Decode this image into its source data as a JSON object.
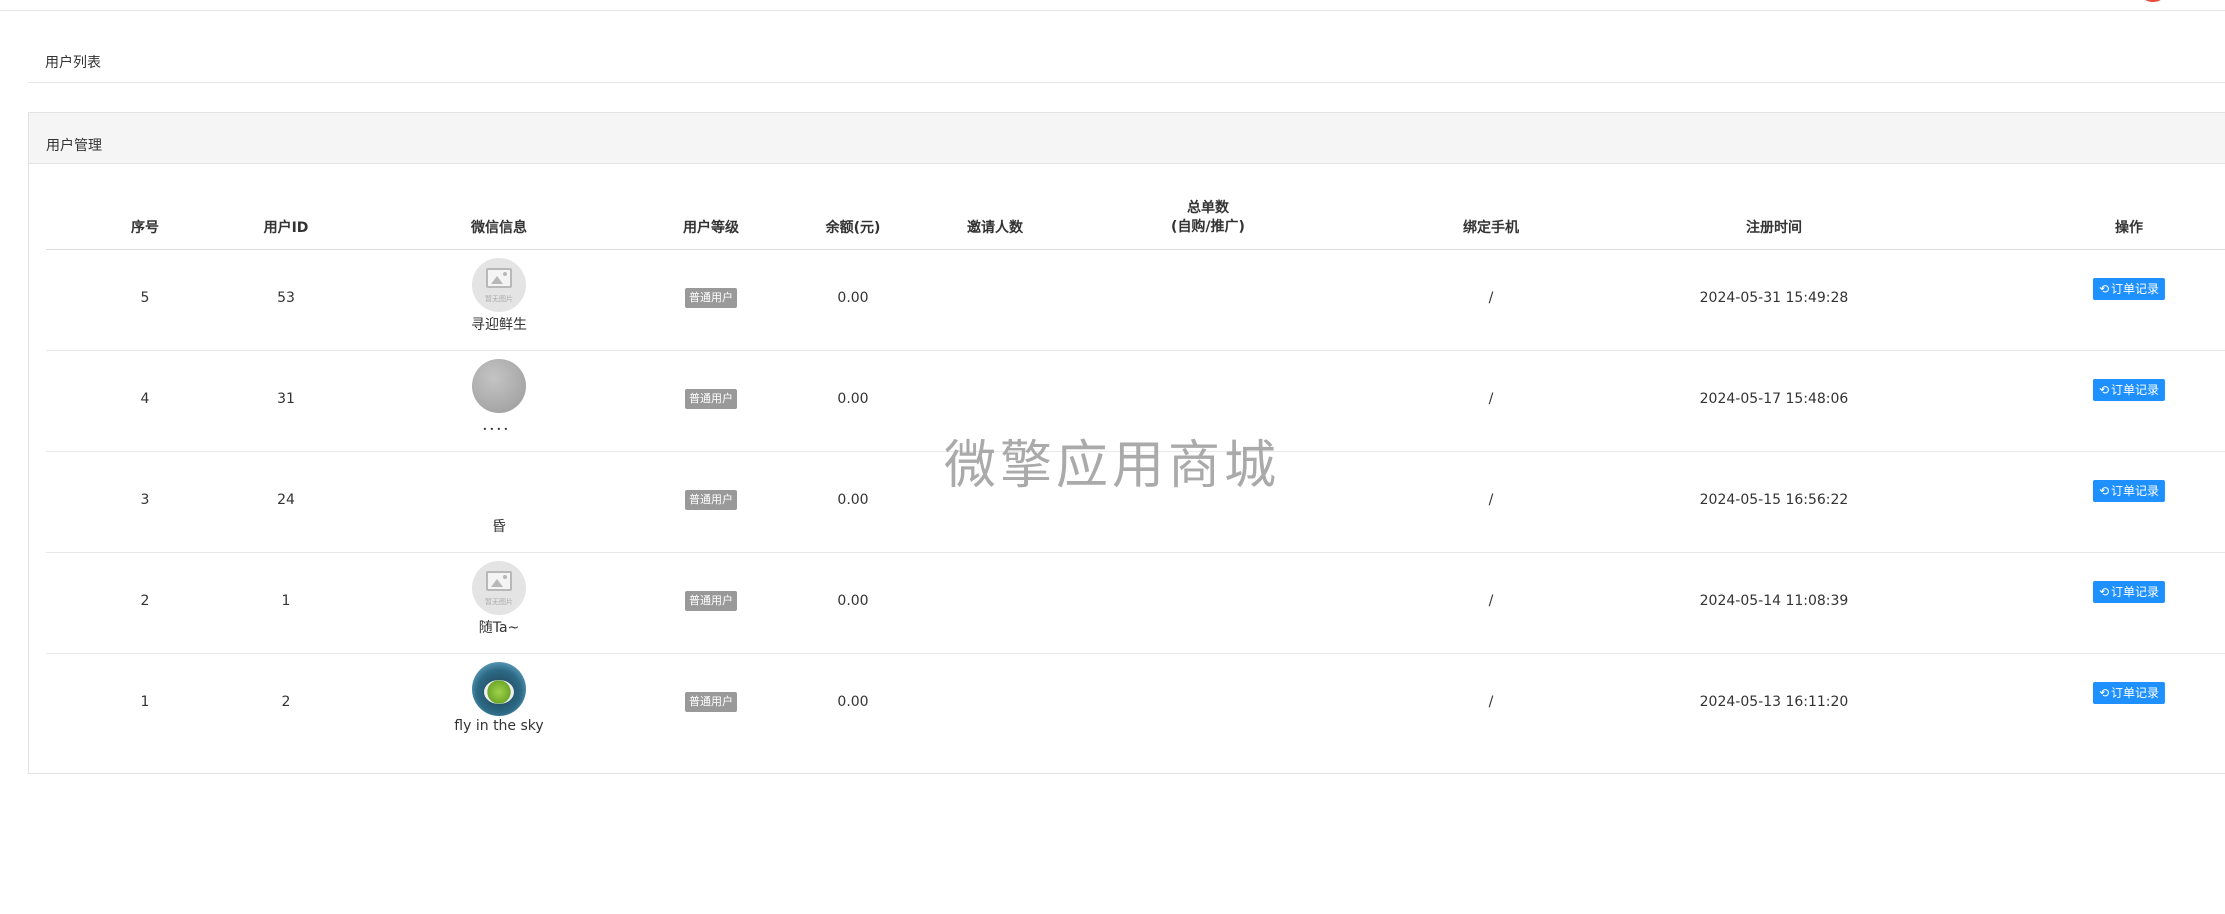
{
  "breadcrumb": "用户列表",
  "panel_title": "用户管理",
  "watermark": "微擎应用商城",
  "columns": {
    "index": "序号",
    "user_id": "用户ID",
    "wechat": "微信信息",
    "level": "用户等级",
    "balance": "余额(元)",
    "invites": "邀请人数",
    "orders_line1": "总单数",
    "orders_line2": "(自购/推广)",
    "phone": "绑定手机",
    "reg_time": "注册时间",
    "action": "操作"
  },
  "rows": [
    {
      "index": "5",
      "user_id": "53",
      "nickname": "寻迎鲜生",
      "avatar": "placeholder",
      "avatar_caption": "暂无图片",
      "level": "普通用户",
      "balance": "0.00",
      "invites": "",
      "orders": "",
      "phone": "/",
      "reg_time": "2024-05-31 15:49:28",
      "action": "订单记录"
    },
    {
      "index": "4",
      "user_id": "31",
      "nickname": "．．．．",
      "avatar": "gray",
      "level": "普通用户",
      "balance": "0.00",
      "invites": "",
      "orders": "",
      "phone": "/",
      "reg_time": "2024-05-17 15:48:06",
      "action": "订单记录"
    },
    {
      "index": "3",
      "user_id": "24",
      "nickname": "昏",
      "avatar": "empty",
      "level": "普通用户",
      "balance": "0.00",
      "invites": "",
      "orders": "",
      "phone": "/",
      "reg_time": "2024-05-15 16:56:22",
      "action": "订单记录"
    },
    {
      "index": "2",
      "user_id": "1",
      "nickname": "随Ta~",
      "avatar": "placeholder",
      "avatar_caption": "暂无图片",
      "level": "普通用户",
      "balance": "0.00",
      "invites": "",
      "orders": "",
      "phone": "/",
      "reg_time": "2024-05-14 11:08:39",
      "action": "订单记录"
    },
    {
      "index": "1",
      "user_id": "2",
      "nickname": "fly in the sky",
      "avatar": "tea",
      "level": "普通用户",
      "balance": "0.00",
      "invites": "",
      "orders": "",
      "phone": "/",
      "reg_time": "2024-05-13 16:11:20",
      "action": "订单记录"
    }
  ],
  "icons": {
    "action_icon": "history-icon"
  }
}
